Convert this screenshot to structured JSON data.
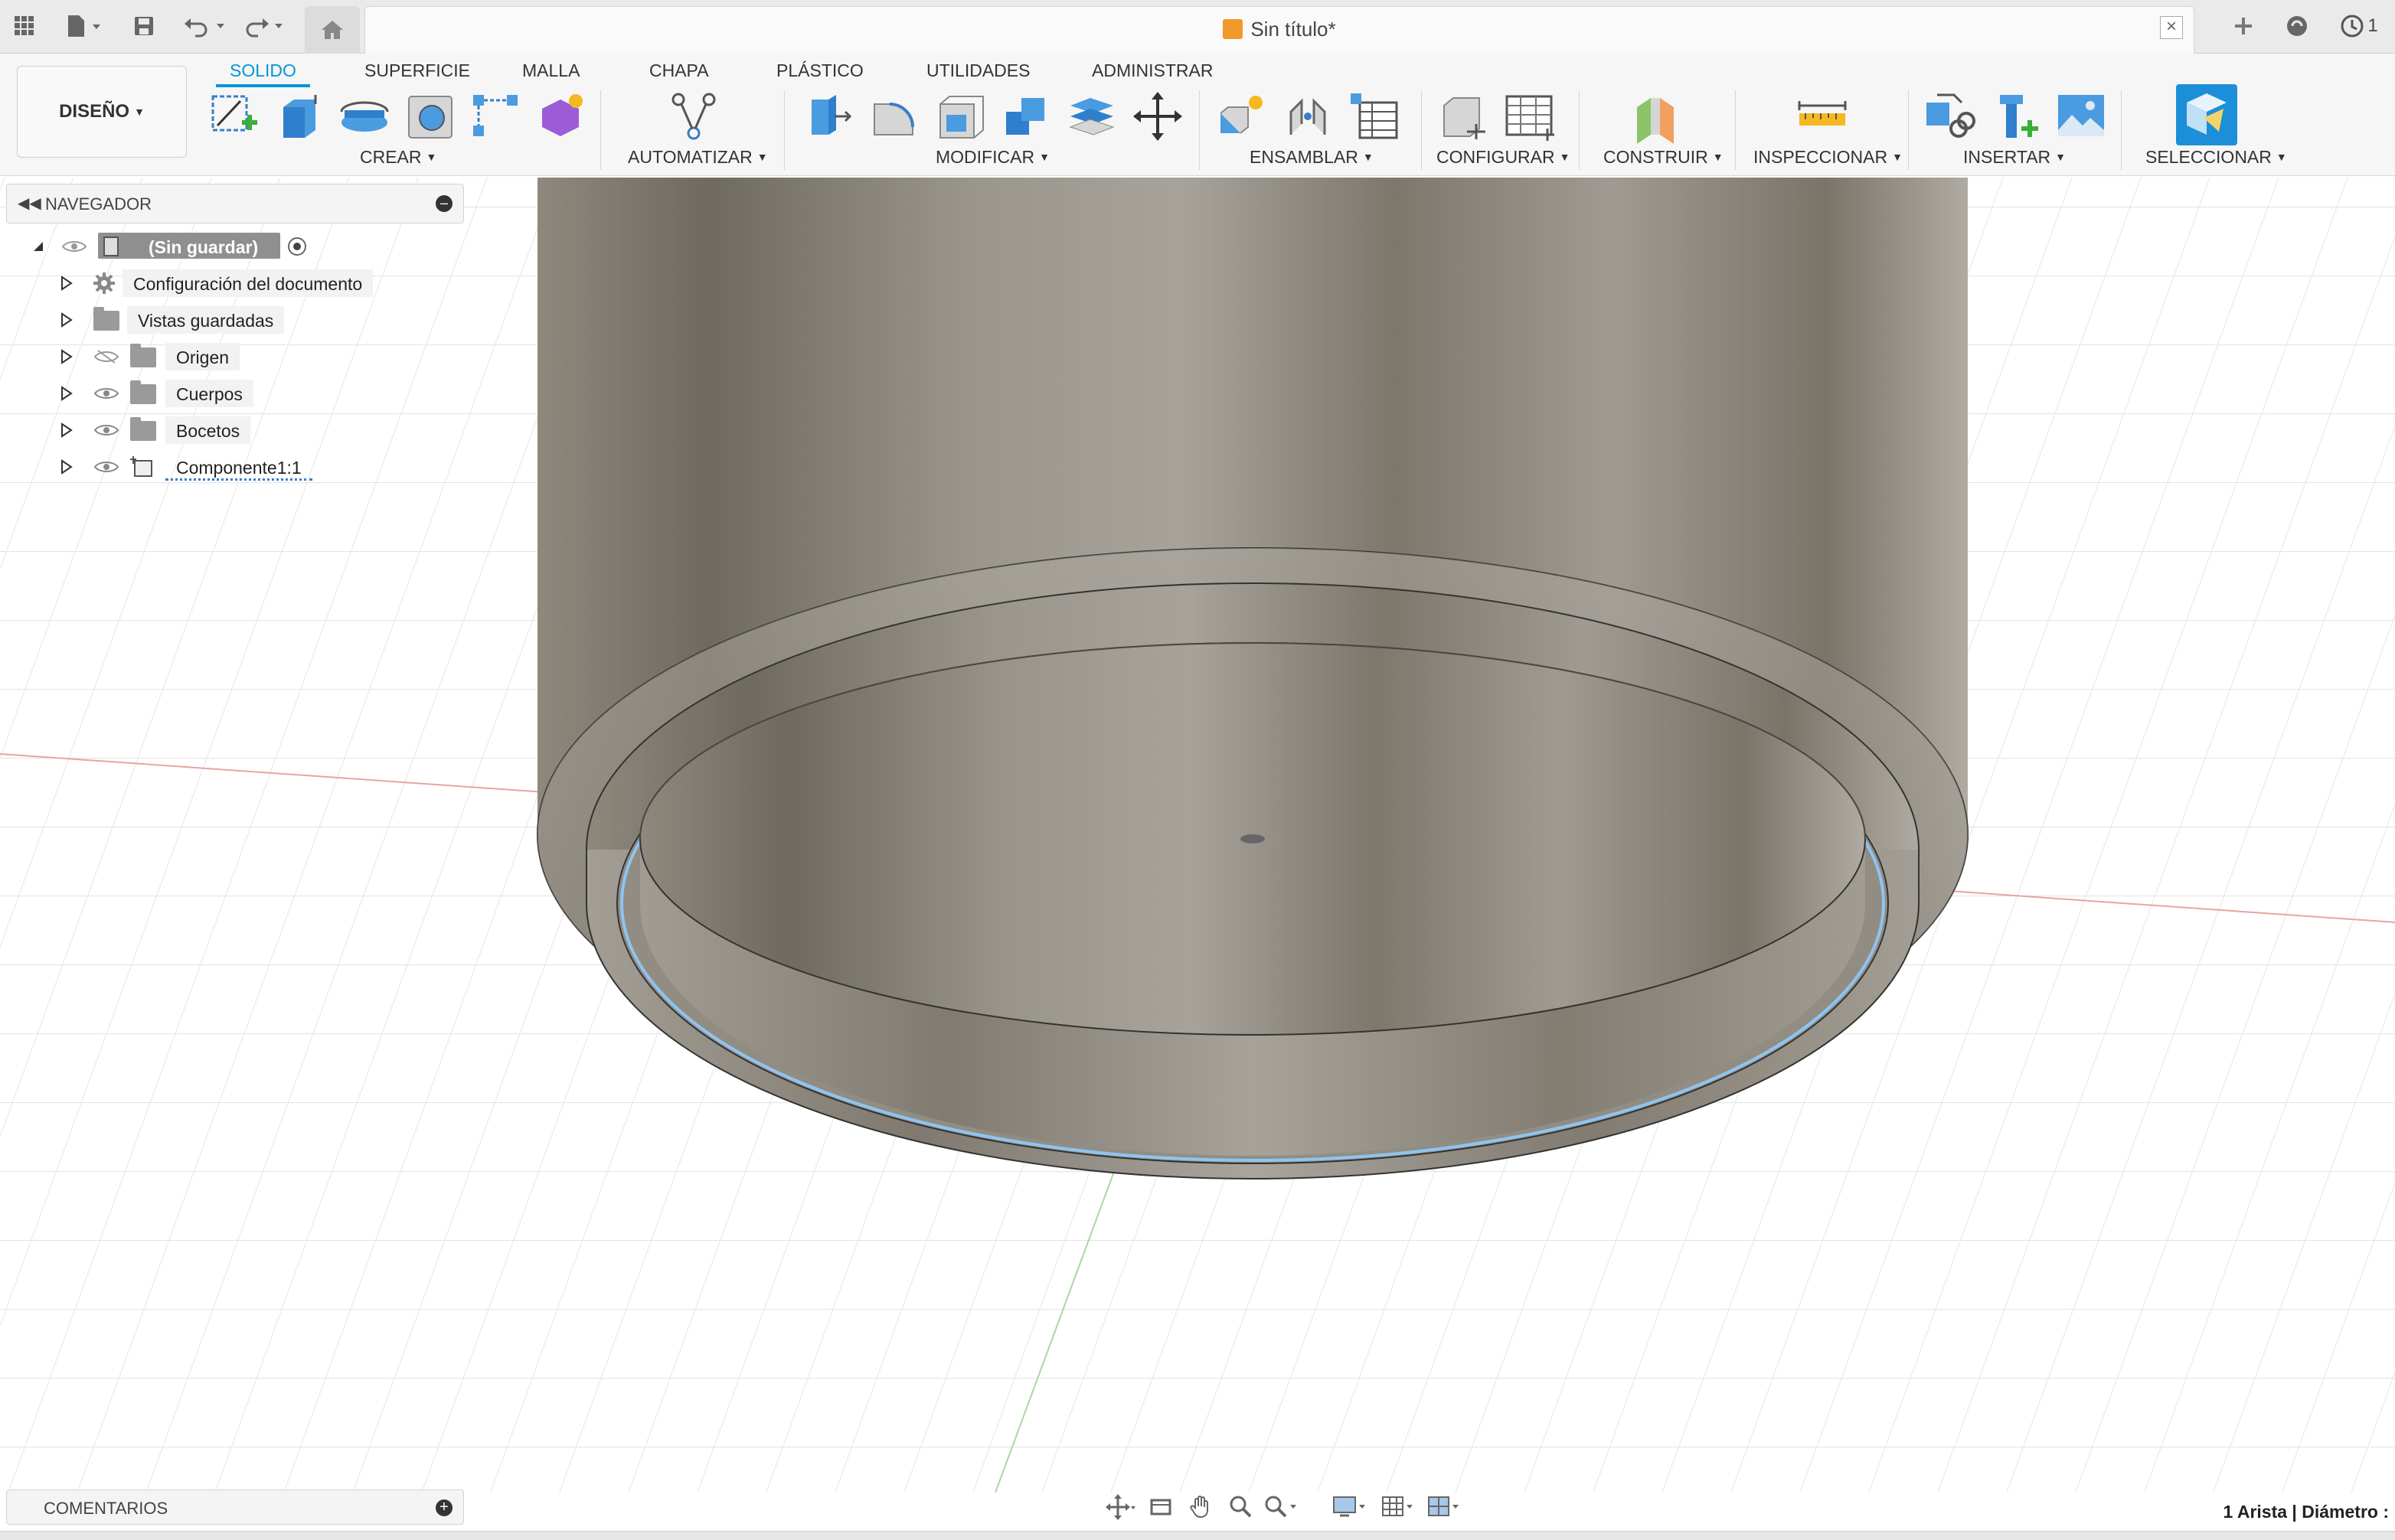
{
  "app": {
    "title": "Sin título*",
    "user_badge": "1"
  },
  "ribbon": {
    "workspace": "DISEÑO",
    "tabs": [
      {
        "label": "SOLIDO",
        "active": true
      },
      {
        "label": "SUPERFICIE",
        "active": false
      },
      {
        "label": "MALLA",
        "active": false
      },
      {
        "label": "CHAPA",
        "active": false
      },
      {
        "label": "PLÁSTICO",
        "active": false
      },
      {
        "label": "UTILIDADES",
        "active": false
      },
      {
        "label": "ADMINISTRAR",
        "active": false
      }
    ],
    "groups": {
      "crear": "CREAR",
      "automatizar": "AUTOMATIZAR",
      "modificar": "MODIFICAR",
      "ensamblar": "ENSAMBLAR",
      "configurar": "CONFIGURAR",
      "construir": "CONSTRUIR",
      "inspeccionar": "INSPECCIONAR",
      "insertar": "INSERTAR",
      "seleccionar": "SELECCIONAR"
    }
  },
  "navigator": {
    "title": "NAVEGADOR",
    "root": "(Sin guardar)",
    "items": [
      {
        "label": "Configuración del documento",
        "icon": "gear-icon"
      },
      {
        "label": "Vistas guardadas",
        "icon": "folder-icon"
      },
      {
        "label": "Origen",
        "icon": "folder-icon",
        "visible": false
      },
      {
        "label": "Cuerpos",
        "icon": "folder-icon",
        "visible": true
      },
      {
        "label": "Bocetos",
        "icon": "folder-icon",
        "visible": true
      },
      {
        "label": "Componente1:1",
        "icon": "component-icon",
        "visible": true
      }
    ]
  },
  "comments": {
    "label": "COMENTARIOS"
  },
  "status": {
    "selection": "1 Arista | Diámetro :"
  },
  "colors": {
    "accent": "#0696d7",
    "body_metal": "#8c867a",
    "selection_edge": "#8ec4f2",
    "grid": "#e3e3e3"
  }
}
